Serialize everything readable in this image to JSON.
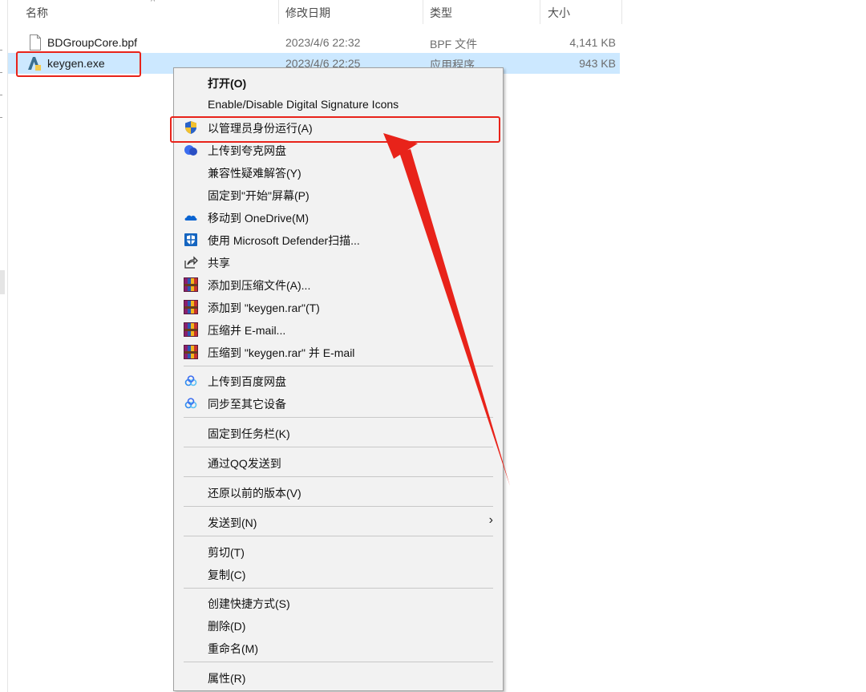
{
  "columns": {
    "name": "名称",
    "date": "修改日期",
    "type": "类型",
    "size": "大小",
    "sort_indicator": "^"
  },
  "files": [
    {
      "icon": "document-icon",
      "name": "BDGroupCore.bpf",
      "date": "2023/4/6 22:32",
      "type": "BPF 文件",
      "size": "4,141 KB"
    },
    {
      "icon": "keygen-app-icon",
      "name": "keygen.exe",
      "date": "2023/4/6 22:25",
      "type": "应用程序",
      "size": "943 KB"
    }
  ],
  "menu": {
    "open": "打开(O)",
    "signature": "Enable/Disable Digital Signature Icons",
    "run_as_admin": "以管理员身份运行(A)",
    "upload_quark": "上传到夸克网盘",
    "compat": "兼容性疑难解答(Y)",
    "pin_start": "固定到\"开始\"屏幕(P)",
    "move_onedrive": "移动到 OneDrive(M)",
    "defender": "使用 Microsoft Defender扫描...",
    "share": "共享",
    "add_archive": "添加到压缩文件(A)...",
    "add_rar": "添加到 \"keygen.rar\"(T)",
    "compress_email": "压缩并 E-mail...",
    "compress_rar_email": "压缩到 \"keygen.rar\" 并 E-mail",
    "upload_baidu": "上传到百度网盘",
    "sync_devices": "同步至其它设备",
    "pin_taskbar": "固定到任务栏(K)",
    "send_qq": "通过QQ发送到",
    "restore_prev": "还原以前的版本(V)",
    "send_to": "发送到(N)",
    "submenu_arrow": "›",
    "cut": "剪切(T)",
    "copy": "复制(C)",
    "create_shortcut": "创建快捷方式(S)",
    "delete": "删除(D)",
    "rename": "重命名(M)",
    "properties": "属性(R)"
  },
  "colors": {
    "annotation_red": "#e8231a",
    "selection": "#cce8ff"
  }
}
